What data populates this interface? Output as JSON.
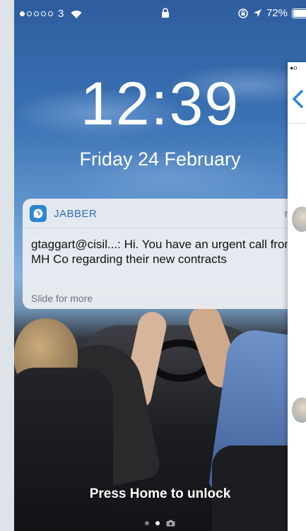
{
  "status_bar": {
    "signal_dots": [
      true,
      false,
      false,
      false,
      false
    ],
    "carrier": "3",
    "battery_percent": "72%",
    "battery_level": 0.72
  },
  "lock_screen": {
    "time": "12:39",
    "date": "Friday 24 February",
    "unlock_hint": "Press Home to unlock",
    "pages": [
      "dot",
      "active-dot",
      "camera"
    ]
  },
  "notification": {
    "app_name": "JABBER",
    "time": "now",
    "message": "gtaggart@cisil...: Hi. You have an urgent call from MH Co regarding their new contracts",
    "footer": "Slide for more"
  },
  "overlay_screen": {
    "status_text": "●o"
  },
  "colors": {
    "accent": "#2f6fb2",
    "app_icon": "#2c86d0",
    "overlay_back_chevron": "#2f86d6"
  },
  "icons": {
    "wifi": "wifi-icon",
    "lock": "lock-icon",
    "rotation_lock": "rotation-lock-icon",
    "location": "location-arrow-icon",
    "battery": "battery-icon",
    "camera": "camera-icon",
    "back": "back-chevron-icon"
  }
}
